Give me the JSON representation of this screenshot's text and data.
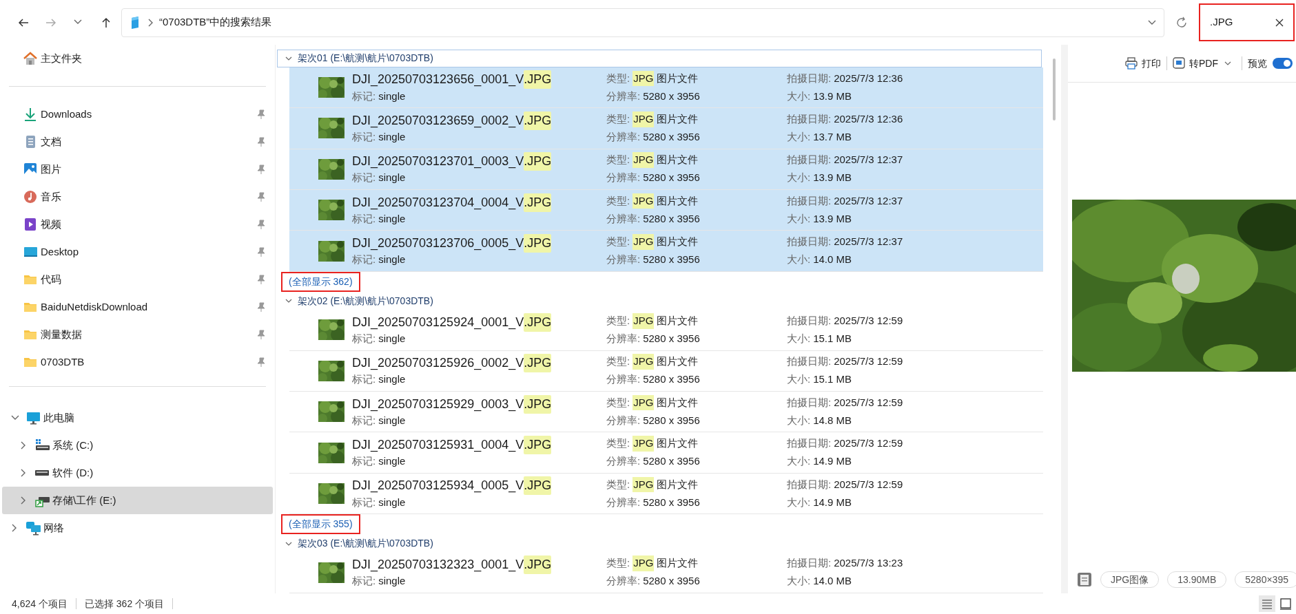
{
  "address": {
    "text": "“0703DTB”中的搜索结果"
  },
  "search": {
    "value": ".JPG",
    "outlined": true
  },
  "sidebar": {
    "home": {
      "label": "主文件夹",
      "kind": "home"
    },
    "pinned": [
      {
        "label": "Downloads",
        "kind": "downloads"
      },
      {
        "label": "文档",
        "kind": "documents"
      },
      {
        "label": "图片",
        "kind": "pictures"
      },
      {
        "label": "音乐",
        "kind": "music"
      },
      {
        "label": "视频",
        "kind": "videos"
      },
      {
        "label": "Desktop",
        "kind": "desktop"
      },
      {
        "label": "代码",
        "kind": "folder"
      },
      {
        "label": "BaiduNetdiskDownload",
        "kind": "folder"
      },
      {
        "label": "测量数据",
        "kind": "folder"
      },
      {
        "label": "0703DTB",
        "kind": "folder"
      }
    ],
    "tree": [
      {
        "label": "此电脑",
        "kind": "pc",
        "expanded": true,
        "selected": false,
        "children": [
          {
            "label": "系统 (C:)",
            "kind": "system-drive",
            "expanded": false,
            "selected": false
          },
          {
            "label": "软件 (D:)",
            "kind": "drive",
            "expanded": false,
            "selected": false
          },
          {
            "label": "存储\\工作 (E:)",
            "kind": "shared-drive",
            "expanded": false,
            "selected": true
          }
        ]
      },
      {
        "label": "网络",
        "kind": "network",
        "expanded": false,
        "selected": false
      }
    ]
  },
  "groups": [
    {
      "title": "架次01 (E:\\航测\\航片\\0703DTB)",
      "expanded": true,
      "focused": true,
      "rows": [
        {
          "name": "DJI_20250703123656_0001_V",
          "match": ".JPG",
          "selected": true,
          "type_label": "类型:",
          "type_match": "JPG",
          "type_text": "图片文件",
          "date_label": "拍摄日期:",
          "date": "2025/7/3 12:36",
          "tag_label": "标记:",
          "tag": "single",
          "res_label": "分辨率:",
          "res": "5280 x 3956",
          "size_label": "大小:",
          "size": "13.9 MB"
        },
        {
          "name": "DJI_20250703123659_0002_V",
          "match": ".JPG",
          "selected": true,
          "type_label": "类型:",
          "type_match": "JPG",
          "type_text": "图片文件",
          "date_label": "拍摄日期:",
          "date": "2025/7/3 12:36",
          "tag_label": "标记:",
          "tag": "single",
          "res_label": "分辨率:",
          "res": "5280 x 3956",
          "size_label": "大小:",
          "size": "13.7 MB"
        },
        {
          "name": "DJI_20250703123701_0003_V",
          "match": ".JPG",
          "selected": true,
          "type_label": "类型:",
          "type_match": "JPG",
          "type_text": "图片文件",
          "date_label": "拍摄日期:",
          "date": "2025/7/3 12:37",
          "tag_label": "标记:",
          "tag": "single",
          "res_label": "分辨率:",
          "res": "5280 x 3956",
          "size_label": "大小:",
          "size": "13.9 MB"
        },
        {
          "name": "DJI_20250703123704_0004_V",
          "match": ".JPG",
          "selected": true,
          "type_label": "类型:",
          "type_match": "JPG",
          "type_text": "图片文件",
          "date_label": "拍摄日期:",
          "date": "2025/7/3 12:37",
          "tag_label": "标记:",
          "tag": "single",
          "res_label": "分辨率:",
          "res": "5280 x 3956",
          "size_label": "大小:",
          "size": "13.9 MB"
        },
        {
          "name": "DJI_20250703123706_0005_V",
          "match": ".JPG",
          "selected": true,
          "type_label": "类型:",
          "type_match": "JPG",
          "type_text": "图片文件",
          "date_label": "拍摄日期:",
          "date": "2025/7/3 12:37",
          "tag_label": "标记:",
          "tag": "single",
          "res_label": "分辨率:",
          "res": "5280 x 3956",
          "size_label": "大小:",
          "size": "14.0 MB"
        }
      ],
      "show_all": {
        "text": "(全部显示 362)",
        "outlined": true
      }
    },
    {
      "title": "架次02 (E:\\航测\\航片\\0703DTB)",
      "expanded": true,
      "focused": false,
      "rows": [
        {
          "name": "DJI_20250703125924_0001_V",
          "match": ".JPG",
          "selected": false,
          "type_label": "类型:",
          "type_match": "JPG",
          "type_text": "图片文件",
          "date_label": "拍摄日期:",
          "date": "2025/7/3 12:59",
          "tag_label": "标记:",
          "tag": "single",
          "res_label": "分辨率:",
          "res": "5280 x 3956",
          "size_label": "大小:",
          "size": "15.1 MB"
        },
        {
          "name": "DJI_20250703125926_0002_V",
          "match": ".JPG",
          "selected": false,
          "type_label": "类型:",
          "type_match": "JPG",
          "type_text": "图片文件",
          "date_label": "拍摄日期:",
          "date": "2025/7/3 12:59",
          "tag_label": "标记:",
          "tag": "single",
          "res_label": "分辨率:",
          "res": "5280 x 3956",
          "size_label": "大小:",
          "size": "15.1 MB"
        },
        {
          "name": "DJI_20250703125929_0003_V",
          "match": ".JPG",
          "selected": false,
          "type_label": "类型:",
          "type_match": "JPG",
          "type_text": "图片文件",
          "date_label": "拍摄日期:",
          "date": "2025/7/3 12:59",
          "tag_label": "标记:",
          "tag": "single",
          "res_label": "分辨率:",
          "res": "5280 x 3956",
          "size_label": "大小:",
          "size": "14.8 MB"
        },
        {
          "name": "DJI_20250703125931_0004_V",
          "match": ".JPG",
          "selected": false,
          "type_label": "类型:",
          "type_match": "JPG",
          "type_text": "图片文件",
          "date_label": "拍摄日期:",
          "date": "2025/7/3 12:59",
          "tag_label": "标记:",
          "tag": "single",
          "res_label": "分辨率:",
          "res": "5280 x 3956",
          "size_label": "大小:",
          "size": "14.9 MB"
        },
        {
          "name": "DJI_20250703125934_0005_V",
          "match": ".JPG",
          "selected": false,
          "type_label": "类型:",
          "type_match": "JPG",
          "type_text": "图片文件",
          "date_label": "拍摄日期:",
          "date": "2025/7/3 12:59",
          "tag_label": "标记:",
          "tag": "single",
          "res_label": "分辨率:",
          "res": "5280 x 3956",
          "size_label": "大小:",
          "size": "14.9 MB"
        }
      ],
      "show_all": {
        "text": "(全部显示 355)",
        "outlined": true
      }
    },
    {
      "title": "架次03 (E:\\航测\\航片\\0703DTB)",
      "expanded": true,
      "focused": false,
      "rows": [
        {
          "name": "DJI_20250703132323_0001_V",
          "match": ".JPG",
          "selected": false,
          "type_label": "类型:",
          "type_match": "JPG",
          "type_text": "图片文件",
          "date_label": "拍摄日期:",
          "date": "2025/7/3 13:23",
          "tag_label": "标记:",
          "tag": "single",
          "res_label": "分辨率:",
          "res": "5280 x 3956",
          "size_label": "大小:",
          "size": "14.0 MB"
        }
      ]
    }
  ],
  "preview": {
    "print": "打印",
    "convert": "转PDF",
    "toggle_label": "预览",
    "on": true,
    "chips": [
      "JPG图像",
      "13.90MB",
      "5280×395"
    ]
  },
  "status_bar": {
    "items": "4,624 个项目",
    "selection": "已选择 362 个项目"
  },
  "views": [
    {
      "kind": "details",
      "selected": true
    },
    {
      "kind": "tiles",
      "selected": false
    }
  ]
}
